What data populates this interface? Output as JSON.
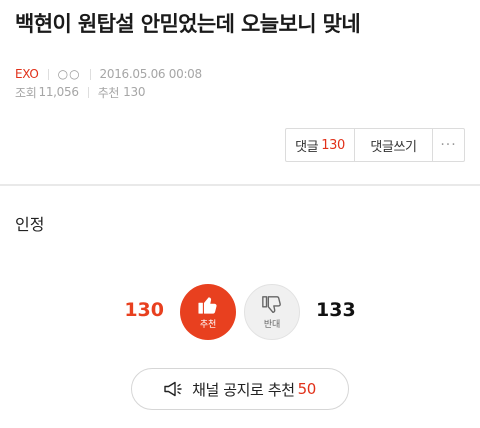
{
  "post": {
    "title": "백현이 원탑설 안믿었는데 오늘보니 맞네",
    "board": "EXO",
    "author": "○○",
    "datetime": "2016.05.06 00:08",
    "views_label": "조회",
    "views": "11,056",
    "recommend_label": "추천",
    "recommend_count": "130",
    "body": "인정"
  },
  "actions": {
    "comments_label": "댓글",
    "comments_count": "130",
    "write_comment_label": "댓글쓰기",
    "more_label": "···"
  },
  "vote": {
    "up_count": "130",
    "up_label": "추천",
    "down_label": "반대",
    "down_count": "133",
    "up_color": "#e8401f"
  },
  "notice": {
    "label": "채널 공지로 추천",
    "count": "50",
    "icon": "megaphone-icon"
  },
  "colors": {
    "accent": "#e1311a",
    "meta_text": "#a6a6a6"
  }
}
